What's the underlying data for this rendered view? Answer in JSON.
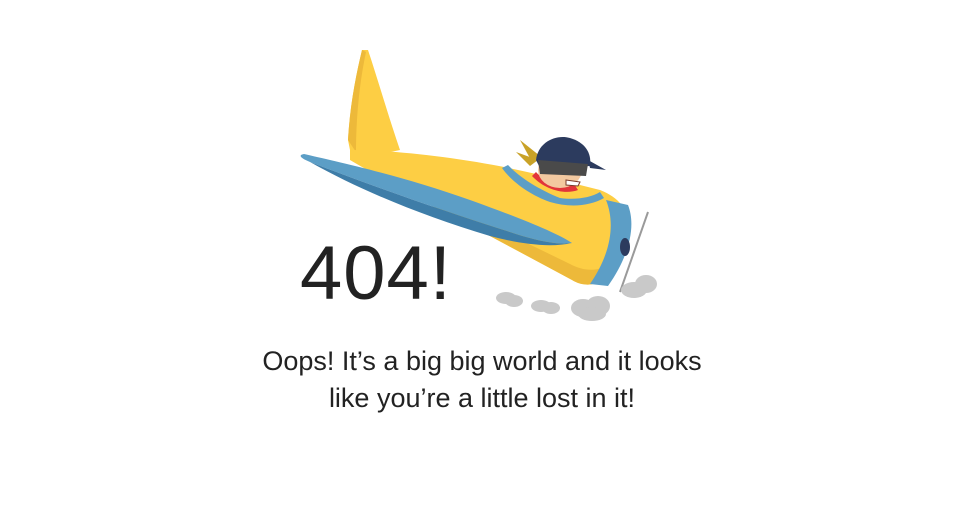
{
  "error": {
    "code": "404!",
    "message_line1": "Oops! It’s a big big world and it looks",
    "message_line2": "like you’re a little lost in it!"
  },
  "illustration": {
    "icon": "airplane-pilot-crash-icon",
    "colors": {
      "plane_body": "#FDCE44",
      "plane_shade": "#EDB93A",
      "wing": "#5C9EC6",
      "wing_dark": "#3E7DA8",
      "helmet": "#2C3B5E",
      "scarf": "#E2353A",
      "goggles": "#4A4A4A",
      "smoke": "#C9C9C9",
      "text": "#222222"
    }
  }
}
